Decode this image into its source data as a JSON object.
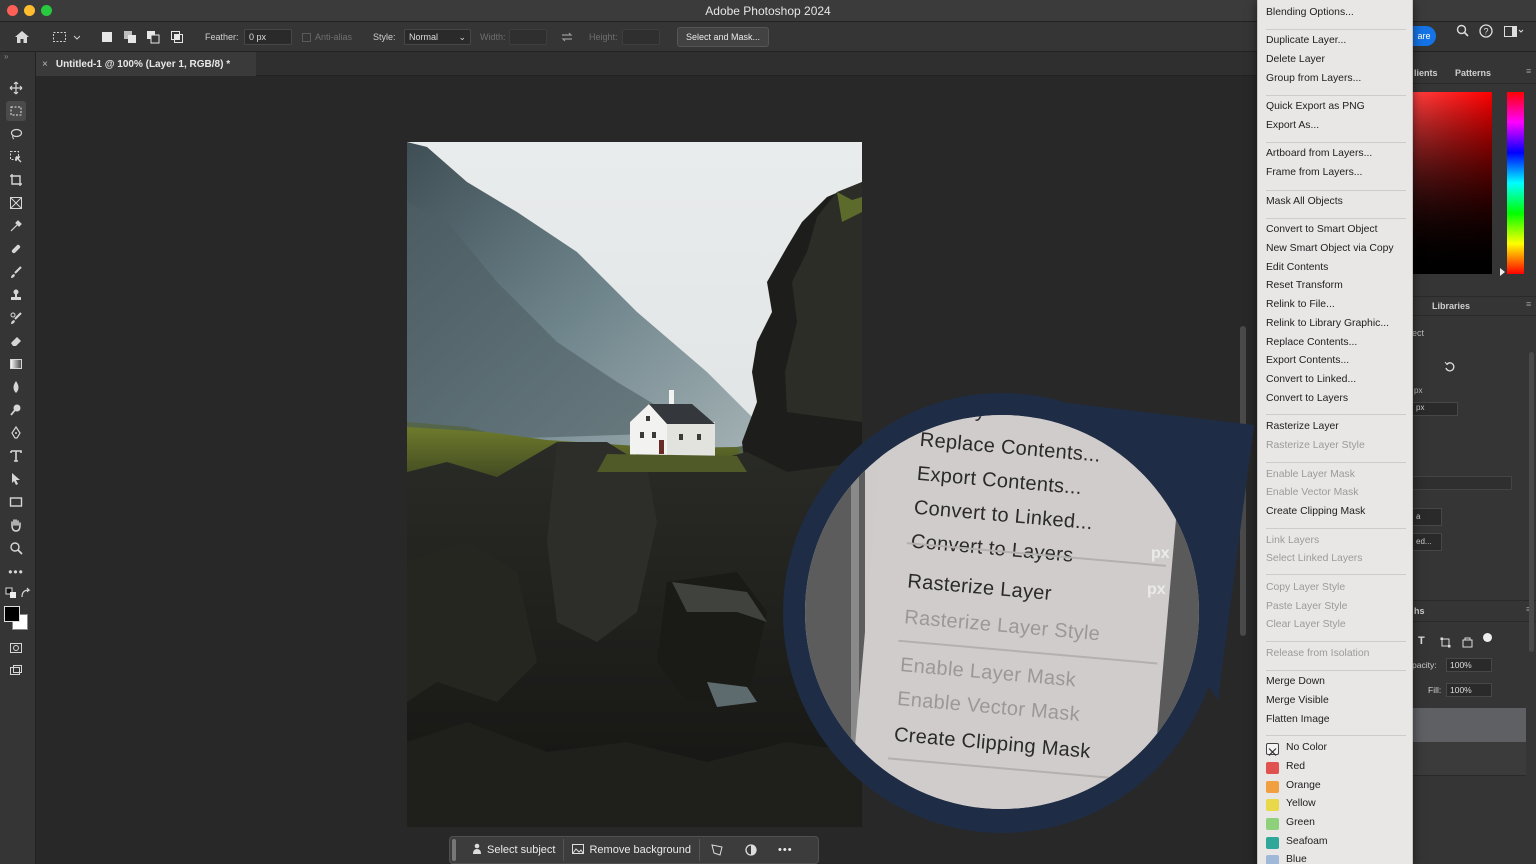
{
  "app": {
    "title": "Adobe Photoshop 2024"
  },
  "options_bar": {
    "feather_label": "Feather:",
    "feather_value": "0 px",
    "anti_alias_label": "Anti-alias",
    "style_label": "Style:",
    "style_value": "Normal",
    "width_label": "Width:",
    "height_label": "Height:",
    "select_mask_label": "Select and Mask..."
  },
  "document_tab": {
    "label": "Untitled-1 @ 100% (Layer 1, RGB/8) *"
  },
  "context_bar": {
    "select_subject": "Select subject",
    "remove_background": "Remove background"
  },
  "right_panel": {
    "share_label": "are",
    "tab_gradients": "lients",
    "tab_patterns": "Patterns",
    "tab_libraries": "Libraries",
    "props_fragment": "ect",
    "px1": "px",
    "px2": "px",
    "field_a": "a",
    "field_b": "ed...",
    "layers_fragment": "hs",
    "opacity_label": "pacity:",
    "opacity_value": "100%",
    "fill_label": "Fill:",
    "fill_value": "100%"
  },
  "context_menu": {
    "items": [
      {
        "label": "Blending Options...",
        "enabled": true
      },
      {
        "label": "Duplicate Layer...",
        "enabled": true
      },
      {
        "label": "Delete Layer",
        "enabled": true
      },
      {
        "label": "Group from Layers...",
        "enabled": true
      },
      {
        "label": "Quick Export as PNG",
        "enabled": true
      },
      {
        "label": "Export As...",
        "enabled": true
      },
      {
        "label": "Artboard from Layers...",
        "enabled": true
      },
      {
        "label": "Frame from Layers...",
        "enabled": true
      },
      {
        "label": "Mask All Objects",
        "enabled": true
      },
      {
        "label": "Convert to Smart Object",
        "enabled": true
      },
      {
        "label": "New Smart Object via Copy",
        "enabled": true
      },
      {
        "label": "Edit Contents",
        "enabled": true
      },
      {
        "label": "Reset Transform",
        "enabled": true
      },
      {
        "label": "Relink to File...",
        "enabled": true
      },
      {
        "label": "Relink to Library Graphic...",
        "enabled": true
      },
      {
        "label": "Replace Contents...",
        "enabled": true
      },
      {
        "label": "Export Contents...",
        "enabled": true
      },
      {
        "label": "Convert to Linked...",
        "enabled": true
      },
      {
        "label": "Convert to Layers",
        "enabled": true
      },
      {
        "label": "Rasterize Layer",
        "enabled": true
      },
      {
        "label": "Rasterize Layer Style",
        "enabled": false
      },
      {
        "label": "Enable Layer Mask",
        "enabled": false
      },
      {
        "label": "Enable Vector Mask",
        "enabled": false
      },
      {
        "label": "Create Clipping Mask",
        "enabled": true
      },
      {
        "label": "Link Layers",
        "enabled": false
      },
      {
        "label": "Select Linked Layers",
        "enabled": false
      },
      {
        "label": "Copy Layer Style",
        "enabled": false
      },
      {
        "label": "Paste Layer Style",
        "enabled": false
      },
      {
        "label": "Clear Layer Style",
        "enabled": false
      },
      {
        "label": "Release from Isolation",
        "enabled": false
      },
      {
        "label": "Merge Down",
        "enabled": true
      },
      {
        "label": "Merge Visible",
        "enabled": true
      },
      {
        "label": "Flatten Image",
        "enabled": true
      }
    ],
    "colors": [
      {
        "label": "No Color",
        "color": "none"
      },
      {
        "label": "Red",
        "color": "#e0524f"
      },
      {
        "label": "Orange",
        "color": "#f0a040"
      },
      {
        "label": "Yellow",
        "color": "#e8d84a"
      },
      {
        "label": "Green",
        "color": "#8fd07a"
      },
      {
        "label": "Seafoam",
        "color": "#2fa89a"
      },
      {
        "label": "Blue",
        "color": "#9fb8d8"
      }
    ]
  },
  "zoom_callout": {
    "items": [
      {
        "label": "Library",
        "enabled": true
      },
      {
        "label": "Replace Contents...",
        "enabled": true
      },
      {
        "label": "Export Contents...",
        "enabled": true
      },
      {
        "label": "Convert to Linked...",
        "enabled": true
      },
      {
        "label": "Convert to Layers",
        "enabled": true
      },
      {
        "label": "Rasterize Layer",
        "enabled": true
      },
      {
        "label": "Rasterize Layer Style",
        "enabled": false
      },
      {
        "label": "Enable Layer Mask",
        "enabled": false
      },
      {
        "label": "Enable Vector Mask",
        "enabled": false
      },
      {
        "label": "Create Clipping Mask",
        "enabled": true
      }
    ],
    "px_a": "px",
    "px_b": "px"
  }
}
